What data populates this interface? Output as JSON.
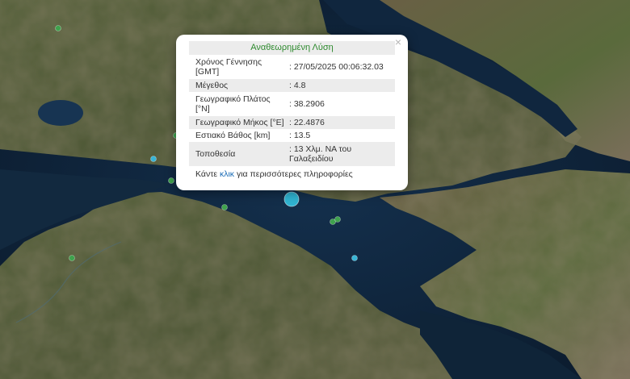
{
  "popup": {
    "title": "Αναθεωρημένη Λύση",
    "close_symbol": "×",
    "rows": [
      {
        "label": "Χρόνος Γέννησης [GMT]",
        "value": ": 27/05/2025 00:06:32.03"
      },
      {
        "label": "Μέγεθος",
        "value": ": 4.8"
      },
      {
        "label": "Γεωγραφικό Πλάτος [°N]",
        "value": ": 38.2906"
      },
      {
        "label": "Γεωγραφικό Μήκος [°E]",
        "value": ": 22.4876"
      },
      {
        "label": "Εστιακό Βάθος [km]",
        "value": ": 13.5"
      },
      {
        "label": "Τοποθεσία",
        "value": ": 13 Χλμ. ΝΑ του Γαλαξειδίου"
      }
    ],
    "more": {
      "prefix": "Κάντε ",
      "link": "κλικ",
      "suffix": " για περισσότερες πληροφορίες"
    }
  },
  "map": {
    "sea_color": "#0f2236",
    "land_color": "#4f5a36",
    "selected_color": "#30b4d2",
    "green_color": "#3fa24d",
    "cyan_color": "#38b5d6"
  }
}
